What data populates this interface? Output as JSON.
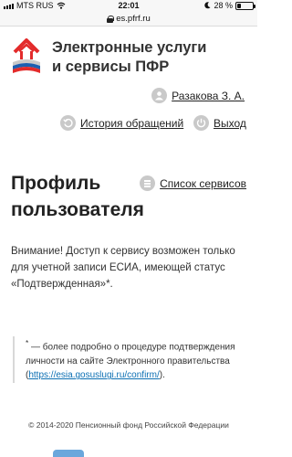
{
  "status_bar": {
    "carrier": "MTS RUS",
    "time": "22:01",
    "battery": "28 %",
    "battery_level": 0.28
  },
  "browser": {
    "url": "es.pfrf.ru"
  },
  "header": {
    "title_line1": "Электронные услуги",
    "title_line2": "и сервисы ПФР",
    "user_name": "Разакова З. А.",
    "history_link": "История обращений",
    "logout_link": "Выход"
  },
  "main": {
    "page_title_line1": "Профиль",
    "page_title_line2": "пользователя",
    "services_link": "Список сервисов",
    "notice": "Внимание! Доступ к сервису возможен только для учетной записи ЕСИА, имеющей статус «Подтвержденная»*.",
    "note_star": "*",
    "note_text": " — более подробно о процедуре подтверждения личности на сайте Электронного правительства (",
    "note_link": "https://esia.gosuslugi.ru/confirm/",
    "note_end": ")."
  },
  "footer": {
    "copyright": "© 2014-2020 Пенсионный фонд Российской Федерации"
  },
  "colors": {
    "brand_red": "#e32b2b",
    "brand_blue": "#1c5fb0",
    "link_blue": "#0b6fb3",
    "icon_gray": "#c9c9c9"
  }
}
